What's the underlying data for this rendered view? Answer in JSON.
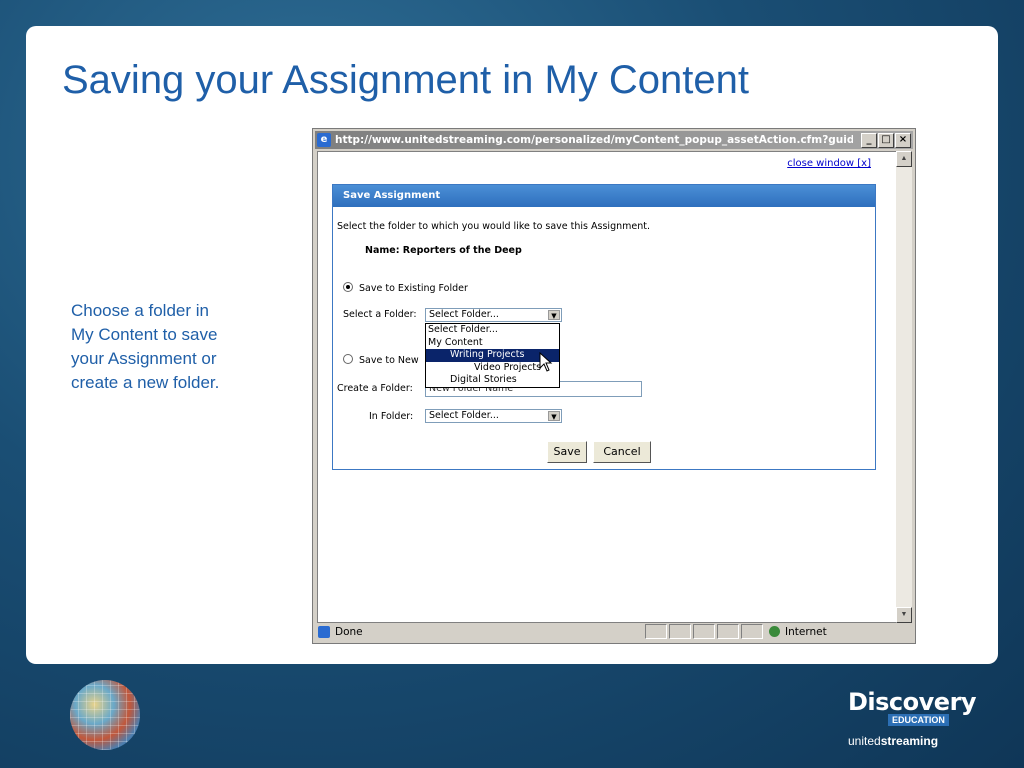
{
  "slide": {
    "title": "Saving your Assignment in My Content",
    "caption": "Choose a folder in\nMy Content to save\nyour Assignment or\ncreate a new folder."
  },
  "browser": {
    "url": "http://www.unitedstreaming.com/personalized/myContent_popup_assetAction.cfm?guidAs...",
    "close_link": "close window [x]",
    "status_text": "Done",
    "zone_text": "Internet"
  },
  "dialog": {
    "header": "Save Assignment",
    "instruction": "Select the folder to which you would like to save this Assignment.",
    "name_line": "Name: Reporters of the Deep",
    "option_existing": "Save to Existing Folder",
    "option_new": "Save to New",
    "select_folder_label": "Select a Folder:",
    "select_folder_value": "Select Folder...",
    "create_folder_label": "Create a Folder:",
    "create_folder_value": "New Folder Name",
    "in_folder_label": "In Folder:",
    "in_folder_value": "Select Folder...",
    "save_button": "Save",
    "cancel_button": "Cancel",
    "dropdown_options": [
      "Select Folder...",
      "My Content",
      "Writing Projects",
      "Video Projects",
      "Digital Stories"
    ]
  },
  "branding": {
    "logo_title": "Discovery",
    "logo_edu": "EDUCATION",
    "logo_sub_a": "united",
    "logo_sub_b": "streaming"
  },
  "colors": {
    "title": "#1f5fa8",
    "dialog_header": "#2e6fbd",
    "highlight": "#0a246a"
  }
}
